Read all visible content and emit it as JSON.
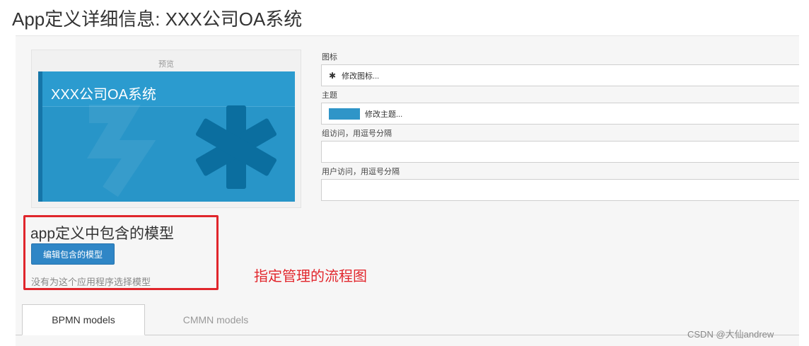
{
  "page": {
    "title": "App定义详细信息: XXX公司OA系统"
  },
  "preview": {
    "label": "预览",
    "app_name": "XXX公司OA系统",
    "icon": "asterisk-icon",
    "tile_color": "#2895c8"
  },
  "fields": {
    "icon_label": "图标",
    "icon_value": "修改图标...",
    "icon_glyph": "✱",
    "theme_label": "主题",
    "theme_value": "修改主题...",
    "theme_color": "#2f95c8",
    "group_access_label": "组访问，用逗号分隔",
    "group_access_value": "",
    "user_access_label": "用户访问，用逗号分隔",
    "user_access_value": ""
  },
  "models": {
    "heading": "app定义中包含的模型",
    "edit_button": "编辑包含的模型",
    "empty_text": "没有为这个应用程序选择模型"
  },
  "annotation": {
    "text": "指定管理的流程图",
    "color": "#e0262c"
  },
  "tabs": [
    {
      "label": "BPMN models",
      "active": true
    },
    {
      "label": "CMMN models",
      "active": false
    }
  ],
  "watermark": "CSDN @大仙andrew"
}
